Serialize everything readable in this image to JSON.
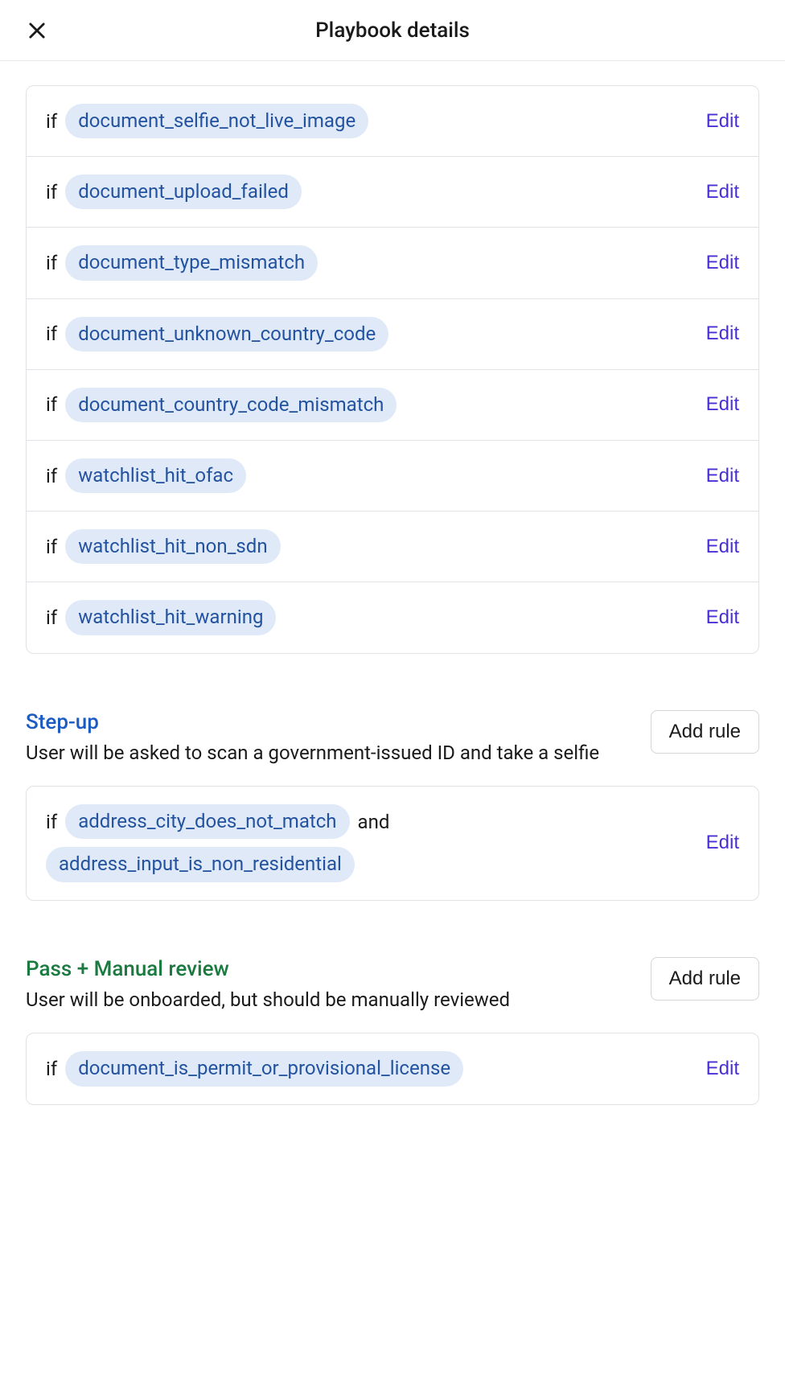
{
  "header": {
    "title": "Playbook details"
  },
  "labels": {
    "if": "if",
    "and": "and",
    "edit": "Edit",
    "add_rule": "Add rule"
  },
  "rules_top": [
    {
      "tags": [
        "document_selfie_not_live_image"
      ]
    },
    {
      "tags": [
        "document_upload_failed"
      ]
    },
    {
      "tags": [
        "document_type_mismatch"
      ]
    },
    {
      "tags": [
        "document_unknown_country_code"
      ]
    },
    {
      "tags": [
        "document_country_code_mismatch"
      ]
    },
    {
      "tags": [
        "watchlist_hit_ofac"
      ]
    },
    {
      "tags": [
        "watchlist_hit_non_sdn"
      ]
    },
    {
      "tags": [
        "watchlist_hit_warning"
      ]
    }
  ],
  "sections": {
    "stepup": {
      "title": "Step-up",
      "description": "User will be asked to scan a government-issued ID and take a selfie",
      "rules": [
        {
          "tags": [
            "address_city_does_not_match",
            "address_input_is_non_residential"
          ]
        }
      ]
    },
    "pass_manual": {
      "title": "Pass + Manual review",
      "description": "User will be onboarded, but should be manually reviewed",
      "rules": [
        {
          "tags": [
            "document_is_permit_or_provisional_license"
          ]
        }
      ]
    }
  }
}
